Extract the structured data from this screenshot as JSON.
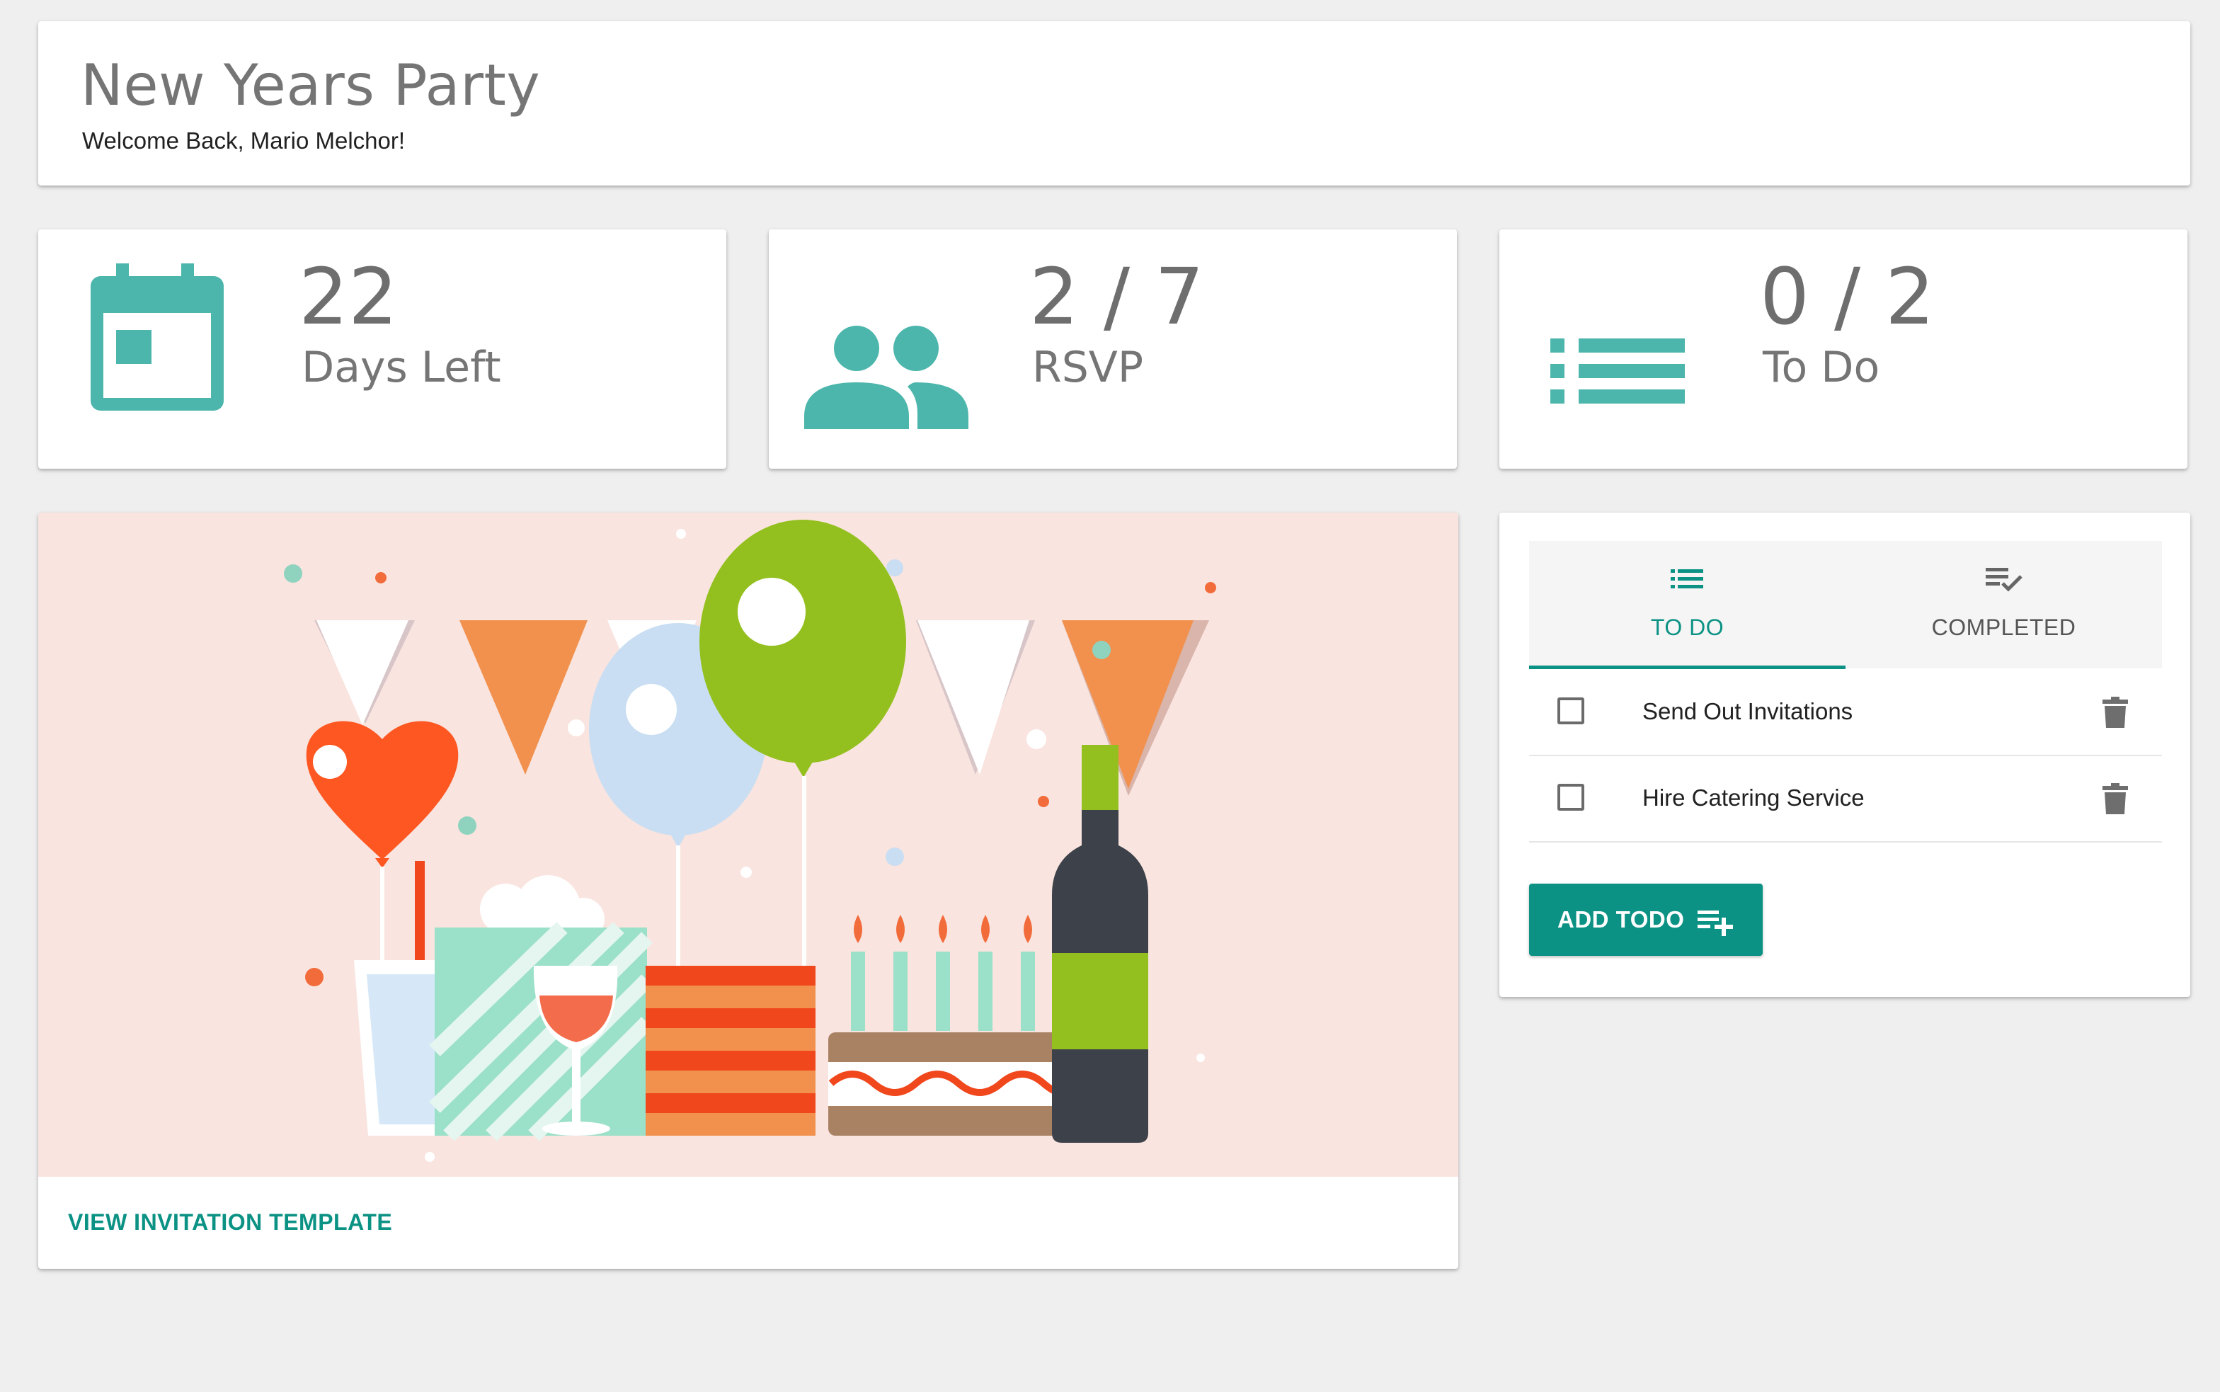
{
  "header": {
    "title": "New Years Party",
    "welcome": "Welcome Back, Mario Melchor!"
  },
  "stats": {
    "days": {
      "value": "22",
      "label": "Days Left",
      "icon": "calendar-icon"
    },
    "rsvp": {
      "value": "2 / 7",
      "label": "RSVP",
      "icon": "people-icon"
    },
    "todo": {
      "value": "0 / 2",
      "label": "To Do",
      "icon": "list-icon"
    }
  },
  "invitation": {
    "image": "party-illustration",
    "link_label": "VIEW INVITATION TEMPLATE"
  },
  "todo_panel": {
    "tabs": [
      {
        "label": "TO DO",
        "icon": "list-icon",
        "active": true
      },
      {
        "label": "COMPLETED",
        "icon": "playlist-check-icon",
        "active": false
      }
    ],
    "items": [
      {
        "label": "Send Out Invitations",
        "checked": false
      },
      {
        "label": "Hire Catering Service",
        "checked": false
      }
    ],
    "add_button_label": "ADD TODO"
  },
  "colors": {
    "accent": "#0b9284",
    "icon_teal": "#4db6ac",
    "background": "#efefef"
  }
}
